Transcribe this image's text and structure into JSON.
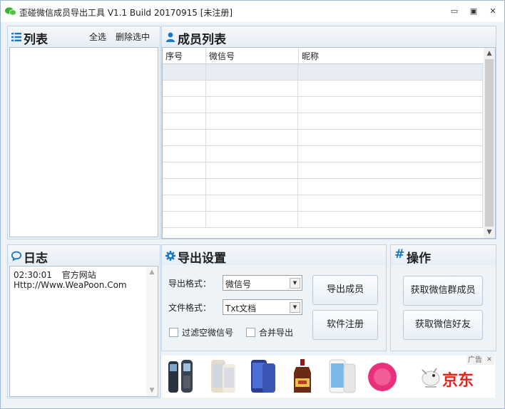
{
  "window": {
    "title": "歪碰微信成员导出工具 V1.1 Build 20170915    [未注册]",
    "minimize": "▭",
    "restore": "▣",
    "close": "✕"
  },
  "list_panel": {
    "title": "列表",
    "select_all": "全选",
    "delete_selected": "删除选中"
  },
  "members_panel": {
    "title": "成员列表",
    "columns": [
      "序号",
      "微信号",
      "昵称"
    ]
  },
  "log_panel": {
    "title": "日志",
    "lines": [
      {
        "time": "02:30:01",
        "text": "官方网站"
      },
      {
        "time": "",
        "text": "Http://Www.WeaPoon.Com"
      }
    ]
  },
  "export_panel": {
    "title": "导出设置",
    "export_format_label": "导出格式：",
    "export_format_value": "微信号",
    "file_format_label": "文件格式：",
    "file_format_value": "Txt文档",
    "filter_empty_label": "过滤空微信号",
    "merge_export_label": "合并导出",
    "export_button": "导出成员",
    "register_button": "软件注册"
  },
  "ops_panel": {
    "title": "操作",
    "get_group_members_button": "获取微信群成员",
    "get_friends_button": "获取微信好友"
  },
  "ad_banner": {
    "ad_label": "广告",
    "close": "✕",
    "brand": "京东",
    "items": [
      "phone-3310",
      "phone-gold",
      "phone-blue",
      "wine-bottle",
      "phone-white",
      "pink-cleanser"
    ]
  },
  "colors": {
    "accent_icon": "#1a78c2",
    "brand_red": "#e1251b",
    "wechat_green": "#3cb034"
  }
}
